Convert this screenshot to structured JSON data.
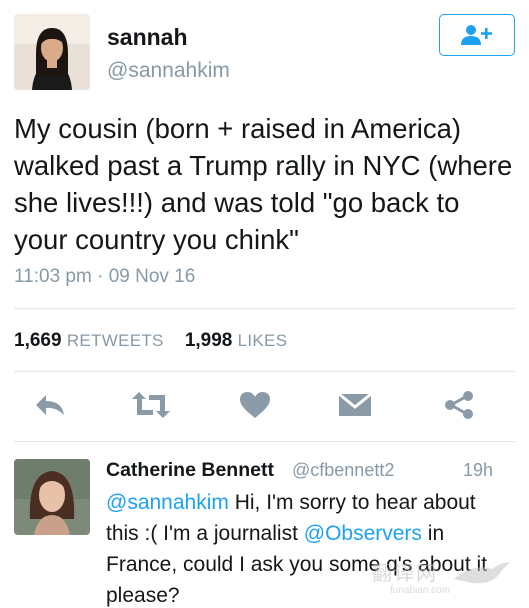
{
  "tweet": {
    "author": {
      "display_name": "sannah",
      "handle": "@sannahkim"
    },
    "text": "My cousin (born + raised in America) walked past a Trump rally in NYC (where she lives!!!) and was told \"go back to your country you chink\"",
    "timestamp": "11:03 pm · 09 Nov 16",
    "stats": {
      "retweets_count": "1,669",
      "retweets_label": "RETWEETS",
      "likes_count": "1,998",
      "likes_label": "LIKES"
    },
    "actions": [
      {
        "name": "reply",
        "icon": "reply-icon"
      },
      {
        "name": "retweet",
        "icon": "retweet-icon"
      },
      {
        "name": "like",
        "icon": "heart-icon"
      },
      {
        "name": "message",
        "icon": "envelope-icon"
      },
      {
        "name": "share",
        "icon": "share-icon"
      }
    ],
    "follow_icon": "follow-user-icon"
  },
  "reply": {
    "display_name": "Catherine Bennett",
    "handle": "@cfbennett2",
    "time": "19h",
    "mention1": "@sannahkim",
    "text1": " Hi, I'm sorry to hear about this :( I'm a journalist ",
    "mention2": "@Observers",
    "text2": " in France, could I ask you some q's about it please?"
  },
  "watermark": {
    "cn": "翻译网",
    "en": "funabian.com"
  },
  "colors": {
    "accent": "#1da1f2",
    "muted": "#8899a6",
    "icon": "#aab8c2",
    "text": "#14171a"
  }
}
